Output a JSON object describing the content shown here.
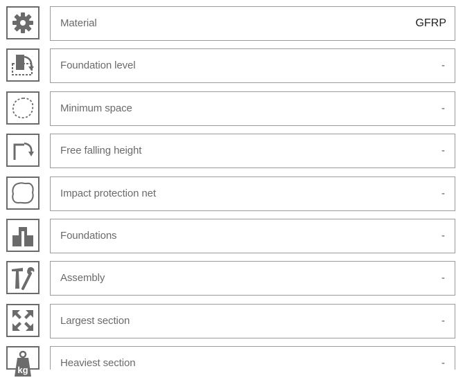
{
  "rows": [
    {
      "icon": "gear-icon",
      "label": "Material",
      "value": "GFRP"
    },
    {
      "icon": "foundation-level-icon",
      "label": "Foundation level",
      "value": "-"
    },
    {
      "icon": "minimum-space-icon",
      "label": "Minimum space",
      "value": "-"
    },
    {
      "icon": "free-falling-height-icon",
      "label": "Free falling height",
      "value": "-"
    },
    {
      "icon": "impact-protection-net-icon",
      "label": "Impact protection net",
      "value": "-"
    },
    {
      "icon": "foundations-icon",
      "label": "Foundations",
      "value": "-"
    },
    {
      "icon": "assembly-tools-icon",
      "label": "Assembly",
      "value": "-"
    },
    {
      "icon": "largest-section-icon",
      "label": "Largest section",
      "value": "-"
    },
    {
      "icon": "weight-kg-icon",
      "label": "Heaviest section",
      "value": "-",
      "icon_text": "kg"
    }
  ],
  "colors": {
    "icon": "#6b6b6b",
    "border": "#9a9a9a",
    "label": "#6a6a6a"
  }
}
